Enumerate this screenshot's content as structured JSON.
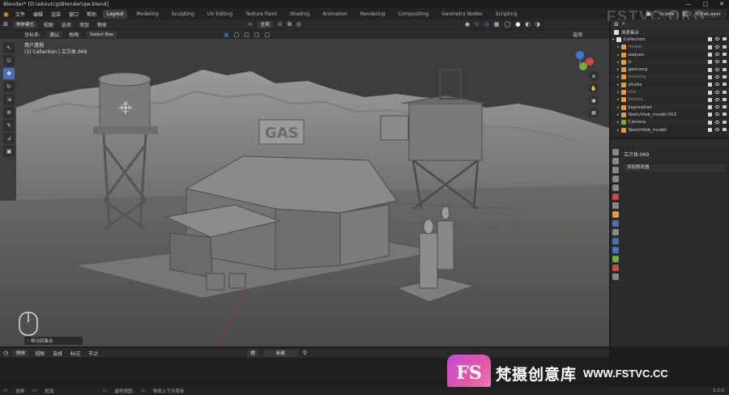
{
  "titlebar": {
    "title": "Blender* [D:\\aboutcg\\Blender\\qw.blend]",
    "controls": [
      "—",
      "□",
      "✕"
    ]
  },
  "menu": [
    "文件",
    "编辑",
    "渲染",
    "窗口",
    "帮助"
  ],
  "workspaces": [
    "Layout",
    "Modeling",
    "Sculpting",
    "UV Editing",
    "Texture Paint",
    "Shading",
    "Animation",
    "Rendering",
    "Compositing",
    "Geometry Nodes",
    "Scripting"
  ],
  "topright": {
    "scene": "Scene",
    "view_layer": "ViewLayer"
  },
  "viewport_header": {
    "mode": "物体模式",
    "view": "视图",
    "select": "选择",
    "add": "添加",
    "object": "物体",
    "transform_orientation": "全局",
    "options": "选项"
  },
  "viewport_header2": {
    "orientation_label": "坐标系:",
    "orientation_value": "默认",
    "drag_label": "拖拽:",
    "drag_value": "Select Box"
  },
  "viewport_overlay": {
    "view_name": "用户透视",
    "collection_info": "(1) Collection | 立方体.069"
  },
  "operator_panel": {
    "label": "移动到集合"
  },
  "outliner": {
    "header": "场景集合",
    "rows": [
      {
        "name": "Collection",
        "icon": "collection-icon",
        "color": "#d0d0d0"
      },
      {
        "name": "mubei",
        "icon": "mesh-icon",
        "color": "#8a8a8a"
      },
      {
        "name": "wajuan",
        "icon": "mesh-icon",
        "color": "#d0d0d0"
      },
      {
        "name": "tr",
        "icon": "mesh-icon",
        "color": "#d0d0d0"
      },
      {
        "name": "gaocang",
        "icon": "mesh-icon",
        "color": "#d0d0d0"
      },
      {
        "name": "baiceng",
        "icon": "mesh-icon",
        "color": "#8a8a8a"
      },
      {
        "name": "shuita",
        "icon": "mesh-icon",
        "color": "#d0d0d0"
      },
      {
        "name": "che",
        "icon": "mesh-icon",
        "color": "#8a8a8a"
      },
      {
        "name": "beiche",
        "icon": "mesh-icon",
        "color": "#8a8a8a"
      },
      {
        "name": "jiayoushan",
        "icon": "mesh-icon",
        "color": "#d0d0d0"
      },
      {
        "name": "Sketchfab_model.003",
        "icon": "armature-icon",
        "color": "#d0d0d0"
      },
      {
        "name": "Camera",
        "icon": "camera-icon",
        "color": "#d0d0d0"
      },
      {
        "name": "Sketchfab_model",
        "icon": "armature-icon",
        "color": "#d0d0d0"
      }
    ]
  },
  "properties": {
    "object_name": "立方体.069",
    "add_modifier": "添加修改器"
  },
  "timeline_header": {
    "playback": "物体",
    "view": "视图",
    "select": "选择",
    "key": "标记",
    "node": "节点",
    "keying": "槽",
    "new": "新建"
  },
  "status": {
    "select": "选择",
    "box": "框选",
    "rotate": "旋转视图",
    "menu": "物体上下文菜单",
    "version": "3.0.0"
  },
  "watermark": {
    "logo": "FS",
    "chinese": "梵摄创意库",
    "url": "WWW.FSTVC.CC",
    "corner": "FSTVC.ORG"
  },
  "colors": {
    "accent": "#4772b3",
    "viewport_bg": "#3d3d3d",
    "orange": "#e89a3c"
  }
}
